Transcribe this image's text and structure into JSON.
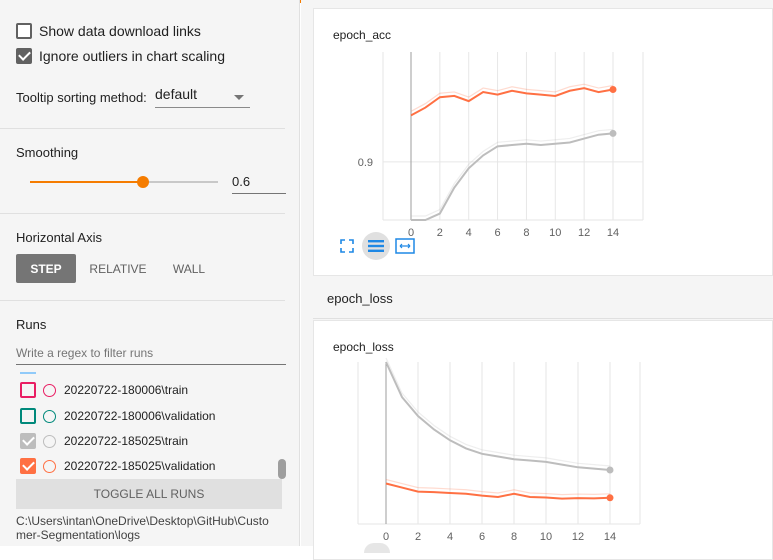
{
  "colors": {
    "accent": "#f57c00",
    "run_train_185025": "#bdbdbd",
    "run_val_185025": "#ff7043",
    "run_train_180006": "#e91e63",
    "run_val_180006": "#00897b"
  },
  "sidebar": {
    "show_download_links": "Show data download links",
    "ignore_outliers": "Ignore outliers in chart scaling",
    "tooltip_label": "Tooltip sorting method:",
    "tooltip_value": "default",
    "smoothing_label": "Smoothing",
    "smoothing_value": "0.6",
    "smoothing_fraction": 0.6,
    "axis_label": "Horizontal Axis",
    "axis_options": [
      "STEP",
      "RELATIVE",
      "WALL"
    ],
    "axis_selected": "STEP",
    "runs_label": "Runs",
    "regex_placeholder": "Write a regex to filter runs",
    "runs": [
      {
        "name": "20220722-180006\\train",
        "checked": false,
        "color": "#e91e63"
      },
      {
        "name": "20220722-180006\\validation",
        "checked": false,
        "color": "#00897b"
      },
      {
        "name": "20220722-185025\\train",
        "checked": true,
        "color": "#bdbdbd"
      },
      {
        "name": "20220722-185025\\validation",
        "checked": true,
        "color": "#ff7043"
      }
    ],
    "toggle_all": "TOGGLE ALL RUNS",
    "logdir": "C:\\Users\\intan\\OneDrive\\Desktop\\GitHub\\Customer-Segmentation\\logs"
  },
  "main": {
    "acc_card_title": "epoch_acc",
    "loss_group_title": "epoch_loss",
    "loss_card_title": "epoch_loss"
  },
  "chart_data": [
    {
      "type": "line",
      "title": "epoch_acc",
      "x": [
        0,
        1,
        2,
        3,
        4,
        5,
        6,
        7,
        8,
        9,
        10,
        11,
        12,
        13,
        14
      ],
      "x_ticks": [
        0,
        2,
        4,
        6,
        8,
        10,
        12,
        14
      ],
      "y_ticks": [
        0.9
      ],
      "series": [
        {
          "name": "20220722-185025\\validation",
          "values": [
            0.936,
            0.942,
            0.95,
            0.951,
            0.947,
            0.954,
            0.952,
            0.955,
            0.953,
            0.952,
            0.951,
            0.955,
            0.957,
            0.954,
            0.956
          ]
        },
        {
          "name": "20220722-185025\\train",
          "values": [
            0.78,
            0.83,
            0.86,
            0.88,
            0.895,
            0.905,
            0.912,
            0.913,
            0.914,
            0.913,
            0.914,
            0.915,
            0.918,
            0.921,
            0.922
          ]
        }
      ]
    },
    {
      "type": "line",
      "title": "epoch_loss",
      "x": [
        0,
        1,
        2,
        3,
        4,
        5,
        6,
        7,
        8,
        9,
        10,
        11,
        12,
        13,
        14
      ],
      "x_ticks": [
        0,
        2,
        4,
        6,
        8,
        10,
        12,
        14
      ],
      "series": [
        {
          "name": "20220722-185025\\train",
          "values": [
            0.8,
            0.62,
            0.55,
            0.5,
            0.46,
            0.43,
            0.41,
            0.4,
            0.39,
            0.385,
            0.38,
            0.37,
            0.36,
            0.355,
            0.35
          ]
        },
        {
          "name": "20220722-185025\\validation",
          "values": [
            0.3,
            0.285,
            0.27,
            0.268,
            0.265,
            0.262,
            0.255,
            0.25,
            0.262,
            0.25,
            0.248,
            0.244,
            0.246,
            0.245,
            0.247
          ]
        }
      ]
    }
  ]
}
